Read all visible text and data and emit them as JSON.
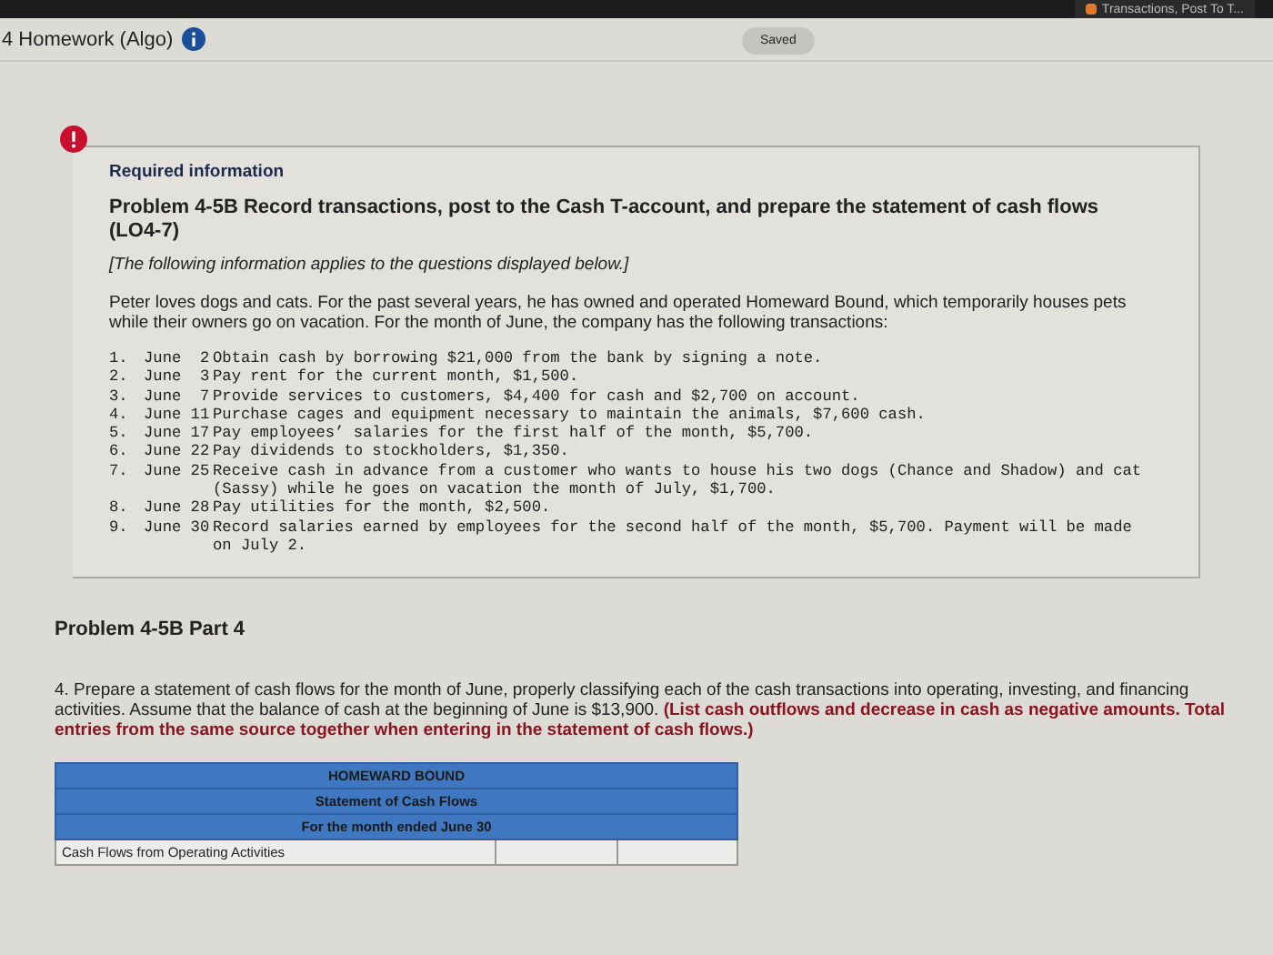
{
  "browser_tab": {
    "title": "Transactions, Post To T..."
  },
  "header": {
    "title": "4 Homework (Algo)",
    "save_status": "Saved"
  },
  "required_info": {
    "heading": "Required information",
    "problem_title": "Problem 4-5B Record transactions, post to the Cash T-account, and prepare the statement of cash flows (LO4-7)",
    "note": "[The following information applies to the questions displayed below.]",
    "intro": "Peter loves dogs and cats. For the past several years, he has owned and operated Homeward Bound, which temporarily houses pets while their owners go on vacation. For the month of June, the company has the following transactions:",
    "transactions": [
      {
        "number": "1.",
        "date": "June  2",
        "text": "Obtain cash by borrowing $21,000 from the bank by signing a note."
      },
      {
        "number": "2.",
        "date": "June  3",
        "text": "Pay rent for the current month, $1,500."
      },
      {
        "number": "3.",
        "date": "June  7",
        "text": "Provide services to customers, $4,400 for cash and $2,700 on account."
      },
      {
        "number": "4.",
        "date": "June 11",
        "text": "Purchase cages and equipment necessary to maintain the animals, $7,600 cash."
      },
      {
        "number": "5.",
        "date": "June 17",
        "text": "Pay employees’ salaries for the first half of the month, $5,700."
      },
      {
        "number": "6.",
        "date": "June 22",
        "text": "Pay dividends to stockholders, $1,350."
      },
      {
        "number": "7.",
        "date": "June 25",
        "text": "Receive cash in advance from a customer who wants to house his two dogs (Chance and Shadow) and cat (Sassy) while he goes on vacation the month of July, $1,700."
      },
      {
        "number": "8.",
        "date": "June 28",
        "text": "Pay utilities for the month, $2,500."
      },
      {
        "number": "9.",
        "date": "June 30",
        "text": "Record salaries earned by employees for the second half of the month, $5,700. Payment will be made on July 2."
      }
    ]
  },
  "part": {
    "title": "Problem 4-5B Part 4",
    "instructions": "4. Prepare a statement of cash flows for the month of June, properly classifying each of the cash transactions into operating, investing, and financing activities. Assume that the balance of cash at the beginning of June is $13,900. **(List cash outflows and decrease in cash as negative amounts. Total entries from the same source together when entering in the statement of cash flows.)**"
  },
  "statement": {
    "header_lines": [
      "HOMEWARD BOUND",
      "Statement of Cash Flows",
      "For the month ended June 30"
    ],
    "rows": [
      {
        "label": "Cash Flows from Operating Activities"
      }
    ]
  }
}
